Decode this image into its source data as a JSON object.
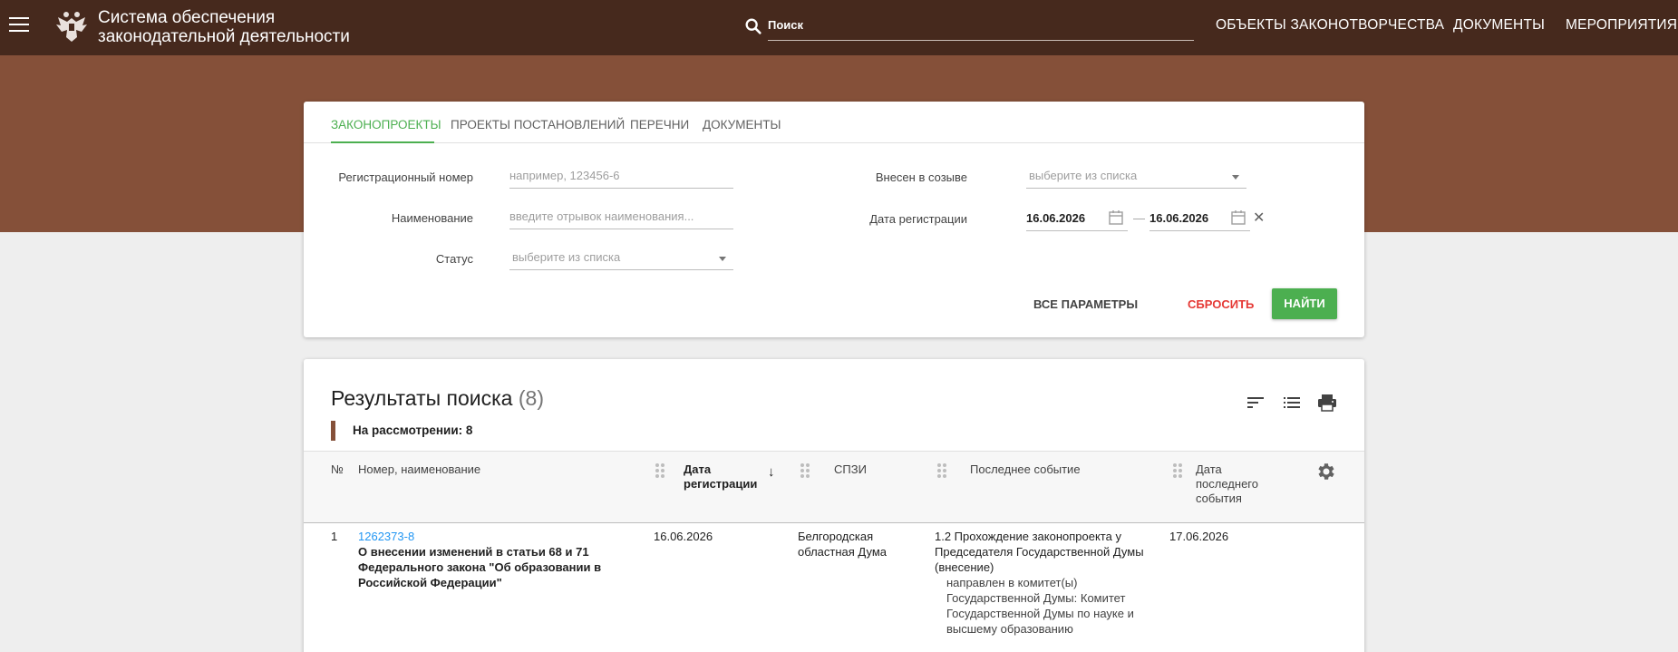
{
  "header": {
    "brand_line1": "Система обеспечения",
    "brand_line2": "законодательной деятельности",
    "search_placeholder": "Поиск",
    "nav": [
      "ОБЪЕКТЫ ЗАКОНОТВОРЧЕСТВА",
      "ДОКУМЕНТЫ",
      "МЕРОПРИЯТИЯ"
    ]
  },
  "search_form": {
    "tabs": [
      {
        "label": "ЗАКОНОПРОЕКТЫ",
        "active": true
      },
      {
        "label": "ПРОЕКТЫ ПОСТАНОВЛЕНИЙ",
        "active": false
      },
      {
        "label": "ПЕРЕЧНИ",
        "active": false
      },
      {
        "label": "ДОКУМЕНТЫ",
        "active": false
      }
    ],
    "reg_number_label": "Регистрационный номер",
    "reg_number_placeholder": "например, 123456-6",
    "name_label": "Наименование",
    "name_placeholder": "введите отрывок наименования...",
    "status_label": "Статус",
    "status_placeholder": "выберите из списка",
    "convocation_label": "Внесен в созыве",
    "convocation_placeholder": "выберите из списка",
    "reg_date_label": "Дата регистрации",
    "date_from": "16.06.2026",
    "date_separator": "—",
    "date_to": "16.06.2026",
    "all_params_button": "ВСЕ ПАРАМЕТРЫ",
    "reset_button": "СБРОСИТЬ",
    "find_button": "НАЙТИ"
  },
  "results": {
    "title": "Результаты поиска",
    "count": "(8)",
    "status_filter": "На рассмотрении: 8",
    "columns": {
      "num": "№",
      "name": "Номер, наименование",
      "reg_date_1": "Дата",
      "reg_date_2": "регистрации",
      "spzi": "СПЗИ",
      "last_event": "Последнее событие",
      "last_event_date_1": "Дата",
      "last_event_date_2": "последнего",
      "last_event_date_3": "события"
    },
    "rows": [
      {
        "num": "1",
        "number": "1262373-8",
        "name_lines": [
          "О внесении изменений в статьи 68 и 71",
          "Федерального закона \"Об образовании в",
          "Российской Федерации\""
        ],
        "reg_date": "16.06.2026",
        "spzi_lines": [
          "Белгородская",
          "областная Дума"
        ],
        "event_lines": [
          "1.2 Прохождение законопроекта у",
          "Председателя Государственной Думы",
          "(внесение)"
        ],
        "event_sub_lines": [
          "направлен в комитет(ы)",
          "Государственной Думы: Комитет",
          "Государственной Думы по науке и",
          "высшему образованию"
        ],
        "event_date": "17.06.2026"
      }
    ]
  },
  "colors": {
    "topbar": "#46291d",
    "band": "#855039",
    "accent_green": "#4caf50",
    "reset_red": "#e53935",
    "link_blue": "#2196f3"
  },
  "icons": [
    "menu-icon",
    "emblem-icon",
    "search-icon",
    "calendar-icon",
    "clear-icon",
    "sort-icon",
    "list-icon",
    "print-icon",
    "drag-handle-icon",
    "sort-down-arrow-icon",
    "gear-icon"
  ]
}
